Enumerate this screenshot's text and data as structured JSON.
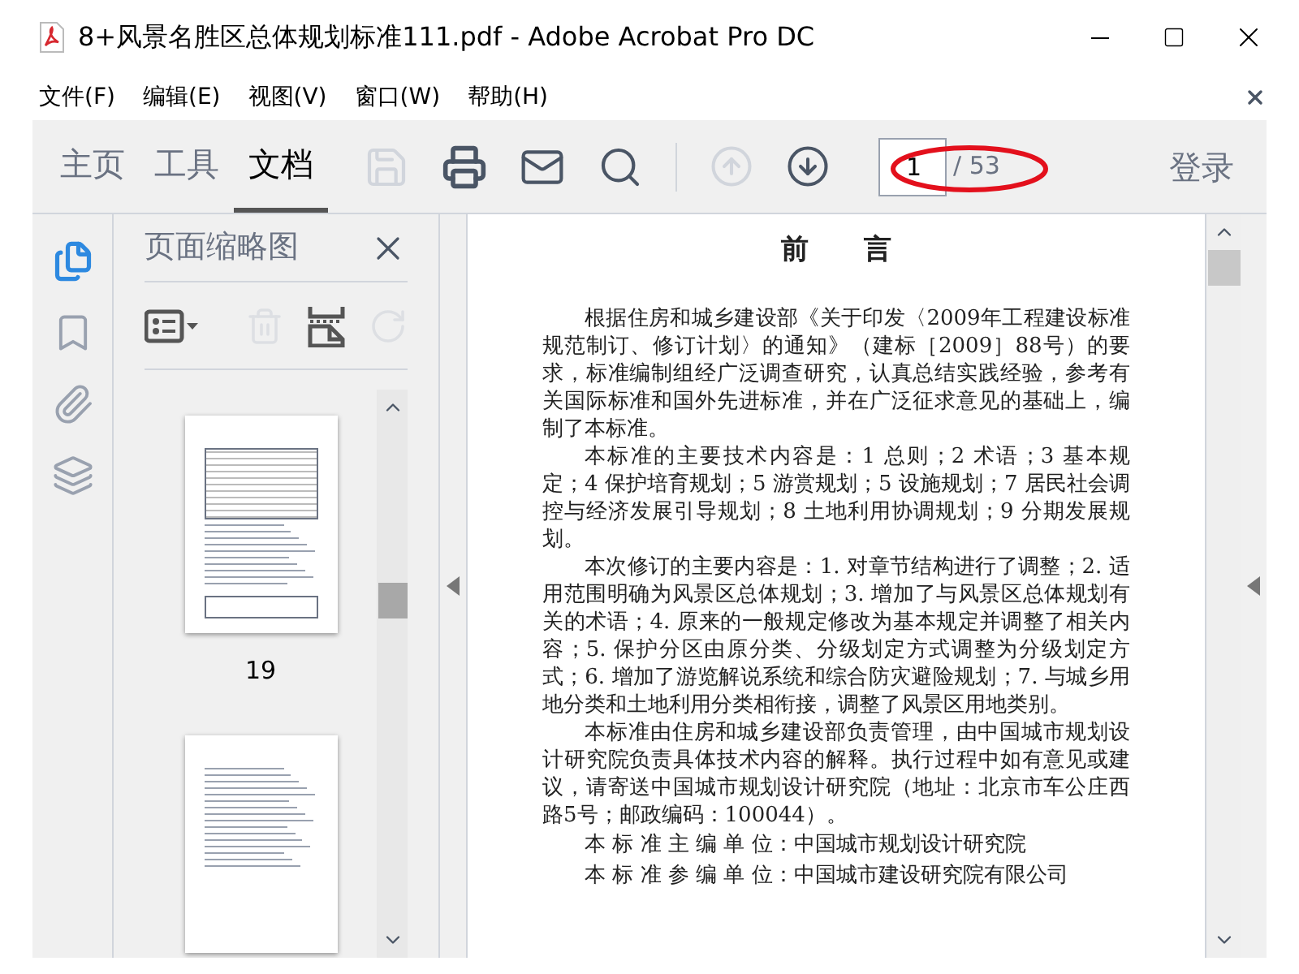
{
  "window": {
    "title": "8+风景名胜区总体规划标准111.pdf - Adobe Acrobat Pro DC"
  },
  "menu": [
    "文件(F)",
    "编辑(E)",
    "视图(V)",
    "窗口(W)",
    "帮助(H)"
  ],
  "tabs": [
    {
      "label": "主页",
      "selected": false
    },
    {
      "label": "工具",
      "selected": false
    },
    {
      "label": "文档",
      "selected": true
    }
  ],
  "tools": [
    {
      "kind": "save",
      "disabled": true
    },
    {
      "kind": "print",
      "disabled": false
    },
    {
      "kind": "mail",
      "disabled": false
    },
    {
      "kind": "search",
      "disabled": false
    },
    {
      "kind": "prev",
      "disabled": true
    },
    {
      "kind": "next",
      "disabled": false
    }
  ],
  "page_nav": {
    "value": "1",
    "total": "/ 53"
  },
  "sign_in": "登录",
  "side_rail": [
    {
      "kind": "pages",
      "selected": true
    },
    {
      "kind": "bookmarks",
      "selected": false
    },
    {
      "kind": "attachments",
      "selected": false
    },
    {
      "kind": "layers",
      "selected": false
    }
  ],
  "thumbnails_panel": {
    "title": "页面缩略图",
    "tools": [
      {
        "kind": "options",
        "disabled": false
      },
      {
        "kind": "delete",
        "disabled": true
      },
      {
        "kind": "insert",
        "disabled": false
      },
      {
        "kind": "rotate",
        "disabled": true
      }
    ],
    "thumbnails": [
      {
        "kind": "table-page",
        "label": "19"
      },
      {
        "kind": "text-page"
      }
    ]
  },
  "document": {
    "heading": "前　　言",
    "paragraphs": [
      "根据住房和城乡建设部《关于印发〈2009年工程建设标准规范制订、修订计划〉的通知》（建标［2009］88号）的要求，标准编制组经广泛调查研究，认真总结实践经验，参考有关国际标准和国外先进标准，并在广泛征求意见的基础上，编制了本标准。",
      "本标准的主要技术内容是：1 总则；2 术语；3 基本规定；4 保护培育规划；5 游赏规划；5 设施规划；7 居民社会调控与经济发展引导规划；8 土地利用协调规划；9 分期发展规划。",
      "本次修订的主要内容是：1. 对章节结构进行了调整；2. 适用范围明确为风景区总体规划；3. 增加了与风景区总体规划有关的术语；4. 原来的一般规定修改为基本规定并调整了相关内容；5. 保护分区由原分类、分级划定方式调整为分级划定方式；6. 增加了游览解说系统和综合防灾避险规划；7. 与城乡用地分类和土地利用分类相衔接，调整了风景区用地类别。",
      "本标准由住房和城乡建设部负责管理，由中国城市规划设计研究院负责具体技术内容的解释。执行过程中如有意见或建议，请寄送中国城市规划设计研究院（地址：北京市车公庄西路5号；邮政编码：100044）。"
    ],
    "units": [
      "本 标 准 主 编 单 位：中国城市规划设计研究院",
      "本 标 准 参 编 单 位：中国城市建设研究院有限公司"
    ]
  }
}
